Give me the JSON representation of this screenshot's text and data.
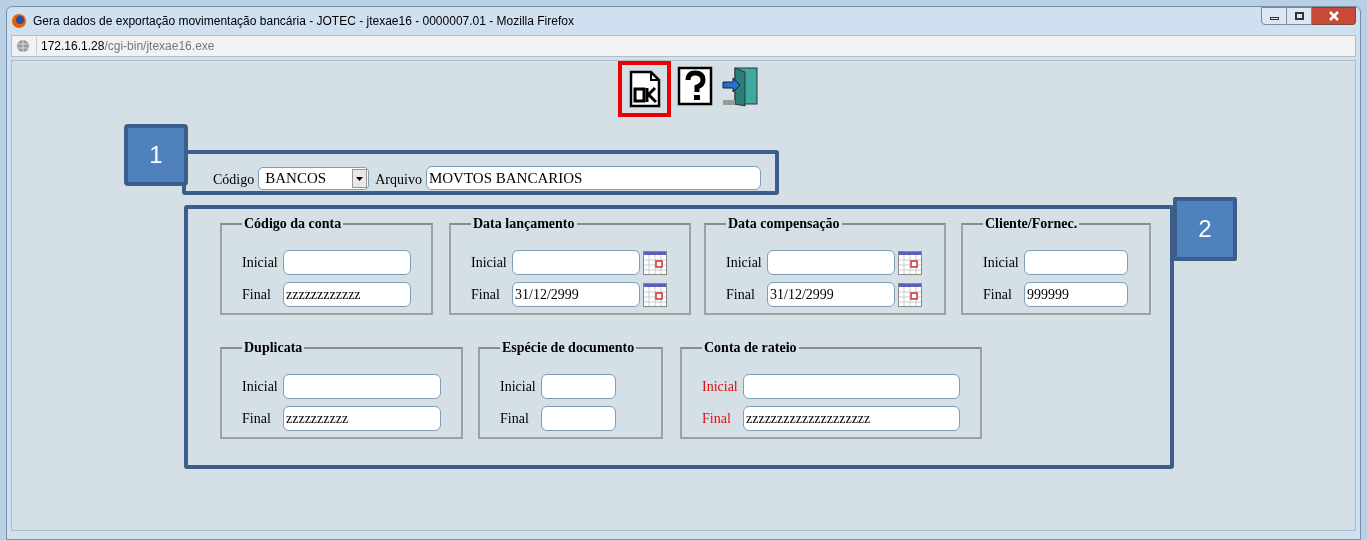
{
  "window": {
    "title": "Gera dados de exportação movimentação bancária - JOTEC - jtexae16 - 0000007.01 - Mozilla Firefox"
  },
  "address_bar": {
    "host": "172.16.1.28",
    "path": "/cgi-bin/jtexae16.exe"
  },
  "markers": [
    "1",
    "2"
  ],
  "section_1": {
    "codigo": {
      "label": "Código",
      "value": "BANCOS"
    },
    "arquivo": {
      "label": "Arquivo",
      "value": "MOVTOS BANCARIOS"
    }
  },
  "groups": [
    {
      "title": "Código da conta",
      "fields": [
        {
          "label": "Inicial",
          "calendar": false,
          "required": false
        },
        {
          "label": "Final",
          "value": "zzzzzzzzzzzz",
          "calendar": false,
          "required": false
        }
      ]
    },
    {
      "title": "Data lançamento",
      "fields": [
        {
          "label": "Inicial",
          "calendar": true,
          "required": false
        },
        {
          "label": "Final",
          "value": "31/12/2999",
          "calendar": true,
          "required": false
        }
      ]
    },
    {
      "title": "Data compensação",
      "fields": [
        {
          "label": "Inicial",
          "calendar": true,
          "required": false
        },
        {
          "label": "Final",
          "value": "31/12/2999",
          "calendar": true,
          "required": false
        }
      ]
    },
    {
      "title": "Cliente/Fornec.",
      "fields": [
        {
          "label": "Inicial",
          "calendar": false,
          "required": false
        },
        {
          "label": "Final",
          "value": "999999",
          "calendar": false,
          "required": false
        }
      ]
    },
    {
      "title": "Duplicata",
      "fields": [
        {
          "label": "Inicial",
          "calendar": false,
          "required": false
        },
        {
          "label": "Final",
          "value": "zzzzzzzzzz",
          "calendar": false,
          "required": false
        }
      ]
    },
    {
      "title": "Espécie de documento",
      "fields": [
        {
          "label": "Inicial",
          "calendar": false,
          "required": false
        },
        {
          "label": "Final",
          "calendar": false,
          "required": false
        }
      ]
    },
    {
      "title": "Conta de rateio",
      "fields": [
        {
          "label": "Inicial",
          "calendar": false,
          "required": true
        },
        {
          "label": "Final",
          "value": "zzzzzzzzzzzzzzzzzzzz",
          "calendar": false,
          "required": true
        }
      ]
    }
  ]
}
